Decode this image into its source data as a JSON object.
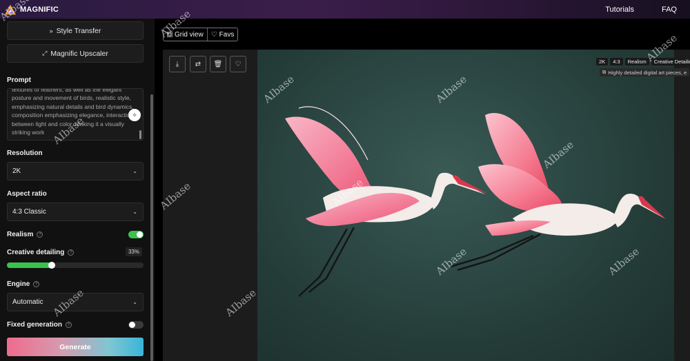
{
  "header": {
    "brand": "MAGNIFIC",
    "nav": [
      "Tutorials",
      "FAQ"
    ]
  },
  "sidebar": {
    "style_transfer": "Style Transfer",
    "upscaler": "Magnific Upscaler",
    "prompt_label": "Prompt",
    "prompt_text": "textures of feathers, as well as the elegant posture and movement of birds, realistic style, emphasizing natural details and bird dynamics, composition emphasizing elegance, interaction between light and color, making it a visually striking work",
    "resolution_label": "Resolution",
    "resolution_value": "2K",
    "aspect_label": "Aspect ratio",
    "aspect_value": "4:3 Classic",
    "realism_label": "Realism",
    "realism_on": true,
    "creative_label": "Creative detailing",
    "creative_value": "33%",
    "creative_fraction": 0.33,
    "engine_label": "Engine",
    "engine_value": "Automatic",
    "fixed_label": "Fixed generation",
    "fixed_on": false,
    "generate_label": "Generate"
  },
  "main": {
    "tabs": [
      "Grid view",
      "Favs"
    ],
    "tools": [
      "download-icon",
      "swap-icon",
      "trash-icon",
      "heart-icon"
    ],
    "tags": [
      "2K",
      "4:3",
      "Realism",
      "Creative Detailing"
    ],
    "caption": "Highly detailed digital art pieces, e"
  },
  "watermark": "AIbase",
  "colors": {
    "accent_green": "#3ac24c",
    "topbar": "#3a1e4a",
    "bird_pink": "#f27a96"
  }
}
